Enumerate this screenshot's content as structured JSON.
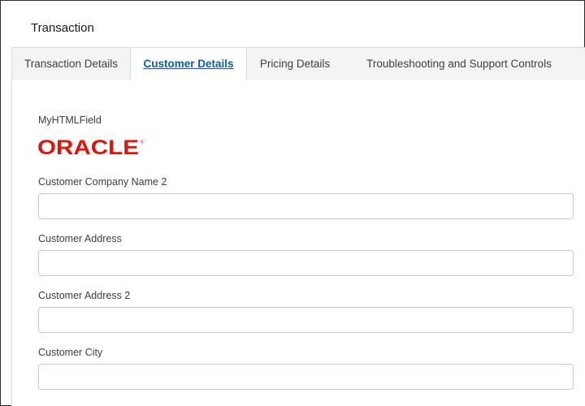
{
  "card": {
    "title": "Transaction"
  },
  "tabs": [
    {
      "label": "Transaction Details",
      "active": false
    },
    {
      "label": "Customer Details",
      "active": true
    },
    {
      "label": "Pricing Details",
      "active": false
    },
    {
      "label": "Troubleshooting and Support Controls",
      "active": false
    }
  ],
  "html_field": {
    "label": "MyHTMLField",
    "logo_text": "ORACLE",
    "logo_color": "#e3120b"
  },
  "fields": [
    {
      "label": "Customer Company Name 2",
      "value": ""
    },
    {
      "label": "Customer Address",
      "value": ""
    },
    {
      "label": "Customer Address 2",
      "value": ""
    },
    {
      "label": "Customer City",
      "value": ""
    }
  ],
  "colors": {
    "active_tab_text": "#0b5cab",
    "tab_bar_bg": "#f3f4f6",
    "border": "#dddbda"
  }
}
